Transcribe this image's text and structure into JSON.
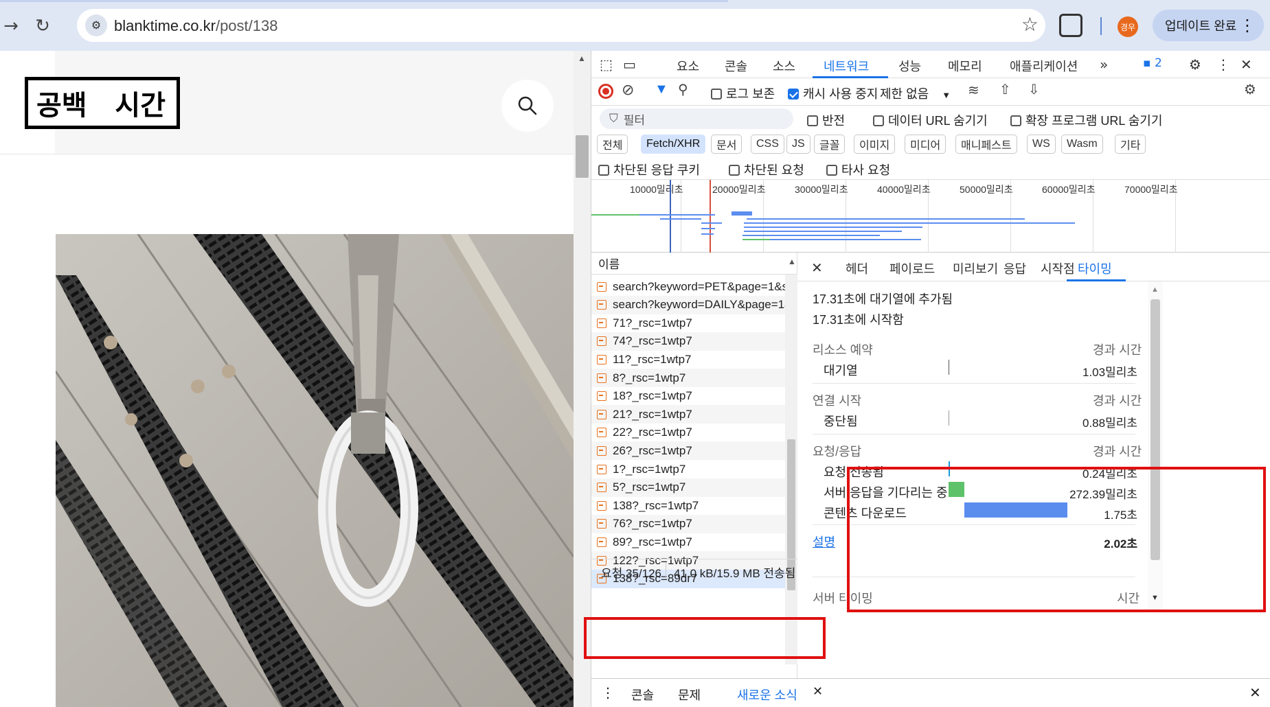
{
  "browser": {
    "url_host": "blanktime.co.kr",
    "url_path": "/post/138",
    "avatar_text": "경우",
    "update_button": "업데이트 완료"
  },
  "page": {
    "logo_left": "공백",
    "logo_right": "시간"
  },
  "devtools": {
    "tabs": [
      "요소",
      "콘솔",
      "소스",
      "네트워크",
      "성능",
      "메모리",
      "애플리케이션"
    ],
    "active_tab": "네트워크",
    "issues_count": "2",
    "toolbar": {
      "preserve_log": "로그 보존",
      "disable_cache": "캐시 사용 중지",
      "throttling": "제한 없음"
    },
    "filter": {
      "placeholder": "필터",
      "invert": "반전",
      "hide_data_urls": "데이터 URL 숨기기",
      "hide_ext_urls": "확장 프로그램 URL 숨기기"
    },
    "types": [
      "전체",
      "Fetch/XHR",
      "문서",
      "CSS",
      "JS",
      "글꼴",
      "이미지",
      "미디어",
      "매니페스트",
      "WS",
      "Wasm",
      "기타"
    ],
    "active_type": "Fetch/XHR",
    "blocked": {
      "blocked_cookies": "차단된 응답 쿠키",
      "blocked_requests": "차단된 요청",
      "third_party": "타사 요청"
    },
    "overview_ticks": [
      "10000밀리초",
      "20000밀리초",
      "30000밀리초",
      "40000밀리초",
      "50000밀리초",
      "60000밀리초",
      "70000밀리초"
    ],
    "request_list": {
      "header": "이름",
      "rows": [
        "search?keyword=PET&page=1&s...",
        "search?keyword=DAILY&page=1&...",
        "71?_rsc=1wtp7",
        "74?_rsc=1wtp7",
        "11?_rsc=1wtp7",
        "8?_rsc=1wtp7",
        "18?_rsc=1wtp7",
        "21?_rsc=1wtp7",
        "22?_rsc=1wtp7",
        "26?_rsc=1wtp7",
        "1?_rsc=1wtp7",
        "5?_rsc=1wtp7",
        "138?_rsc=1wtp7",
        "76?_rsc=1wtp7",
        "89?_rsc=1wtp7",
        "122?_rsc=1wtp7",
        "138?_rsc=89dr7"
      ],
      "status_requests": "요청 35/126",
      "status_transferred": "41.0 kB/15.9 MB 전송됨"
    },
    "detail": {
      "tabs": [
        "헤더",
        "페이로드",
        "미리보기",
        "응답",
        "시작점",
        "타이밍"
      ],
      "active_tab": "타이밍",
      "queued_at": "17.31초에 대기열에 추가됨",
      "started_at": "17.31초에 시작함",
      "resource_scheduling": {
        "label": "리소스 예약",
        "duration_label": "경과 시간",
        "queueing_label": "대기열",
        "queueing_value": "1.03밀리초"
      },
      "connection_start": {
        "label": "연결 시작",
        "duration_label": "경과 시간",
        "stalled_label": "중단됨",
        "stalled_value": "0.88밀리초"
      },
      "request_response": {
        "label": "요청/응답",
        "duration_label": "경과 시간",
        "request_sent_label": "요청 전송됨",
        "request_sent_value": "0.24밀리초",
        "waiting_label": "서버 응답을 기다리는 중",
        "waiting_value": "272.39밀리초",
        "download_label": "콘텐츠 다운로드",
        "download_value": "1.75초"
      },
      "explanation": "설명",
      "total": "2.02초",
      "server_timing": "서버 타이밍",
      "server_timing_col": "시간"
    },
    "drawer_tabs": [
      "콘솔",
      "문제",
      "새로운 소식"
    ]
  },
  "colors": {
    "accent": "#1a73e8",
    "highlight_box": "#e01010",
    "waiting_bar": "#5ec26a",
    "download_bar": "#5b8def"
  }
}
